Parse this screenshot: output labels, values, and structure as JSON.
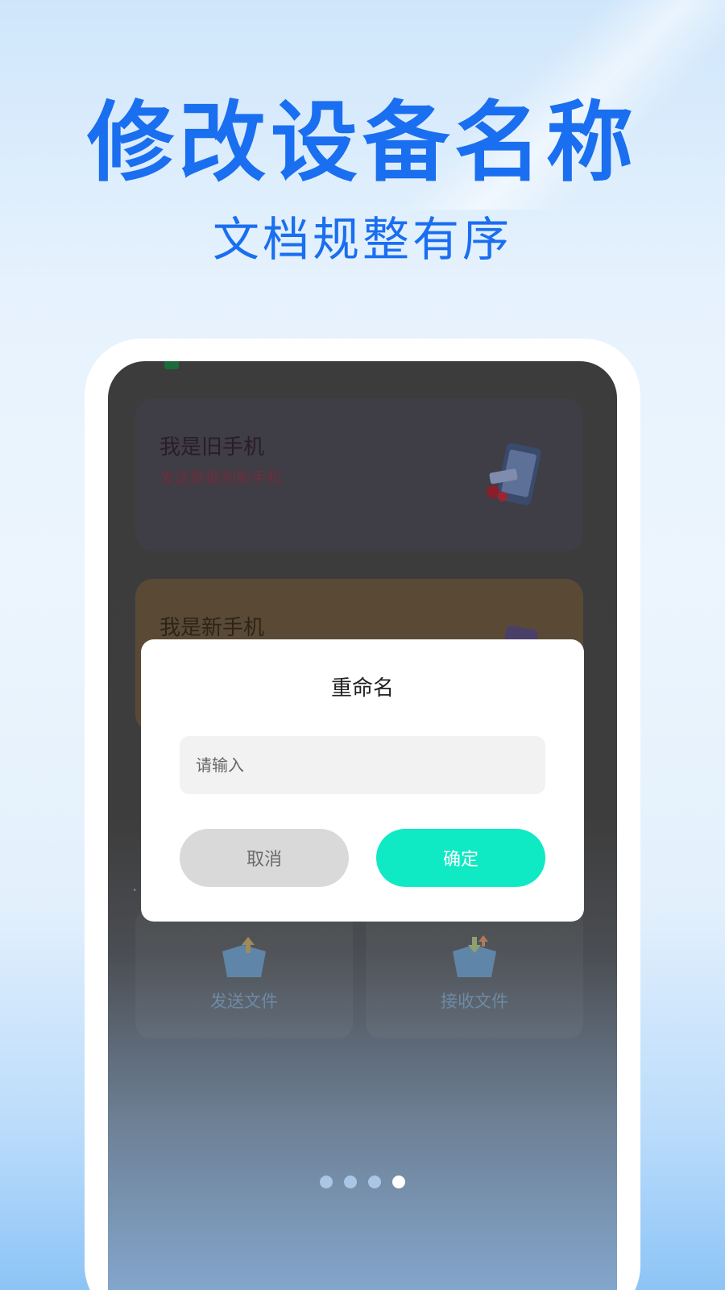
{
  "promo": {
    "headline": "修改设备名称",
    "subline": "文档规整有序"
  },
  "colors": {
    "brand_blue": "#1a6ef0",
    "confirm_green": "#0fe9c4",
    "cancel_gray": "#d9d9d9"
  },
  "screen": {
    "cards": [
      {
        "title": "我是旧手机",
        "subtitle": "发送数据到新手机",
        "icon": "old-phone-illustration"
      },
      {
        "title": "我是新手机",
        "icon": "new-phone-illustration"
      }
    ],
    "tiles": [
      {
        "label": "发送文件",
        "icon": "send-file-icon"
      },
      {
        "label": "接收文件",
        "icon": "receive-file-icon"
      }
    ]
  },
  "dialog": {
    "title": "重命名",
    "input_placeholder": "请输入",
    "input_value": "",
    "cancel_label": "取消",
    "confirm_label": "确定"
  },
  "pager": {
    "total": 4,
    "active_index": 3
  }
}
